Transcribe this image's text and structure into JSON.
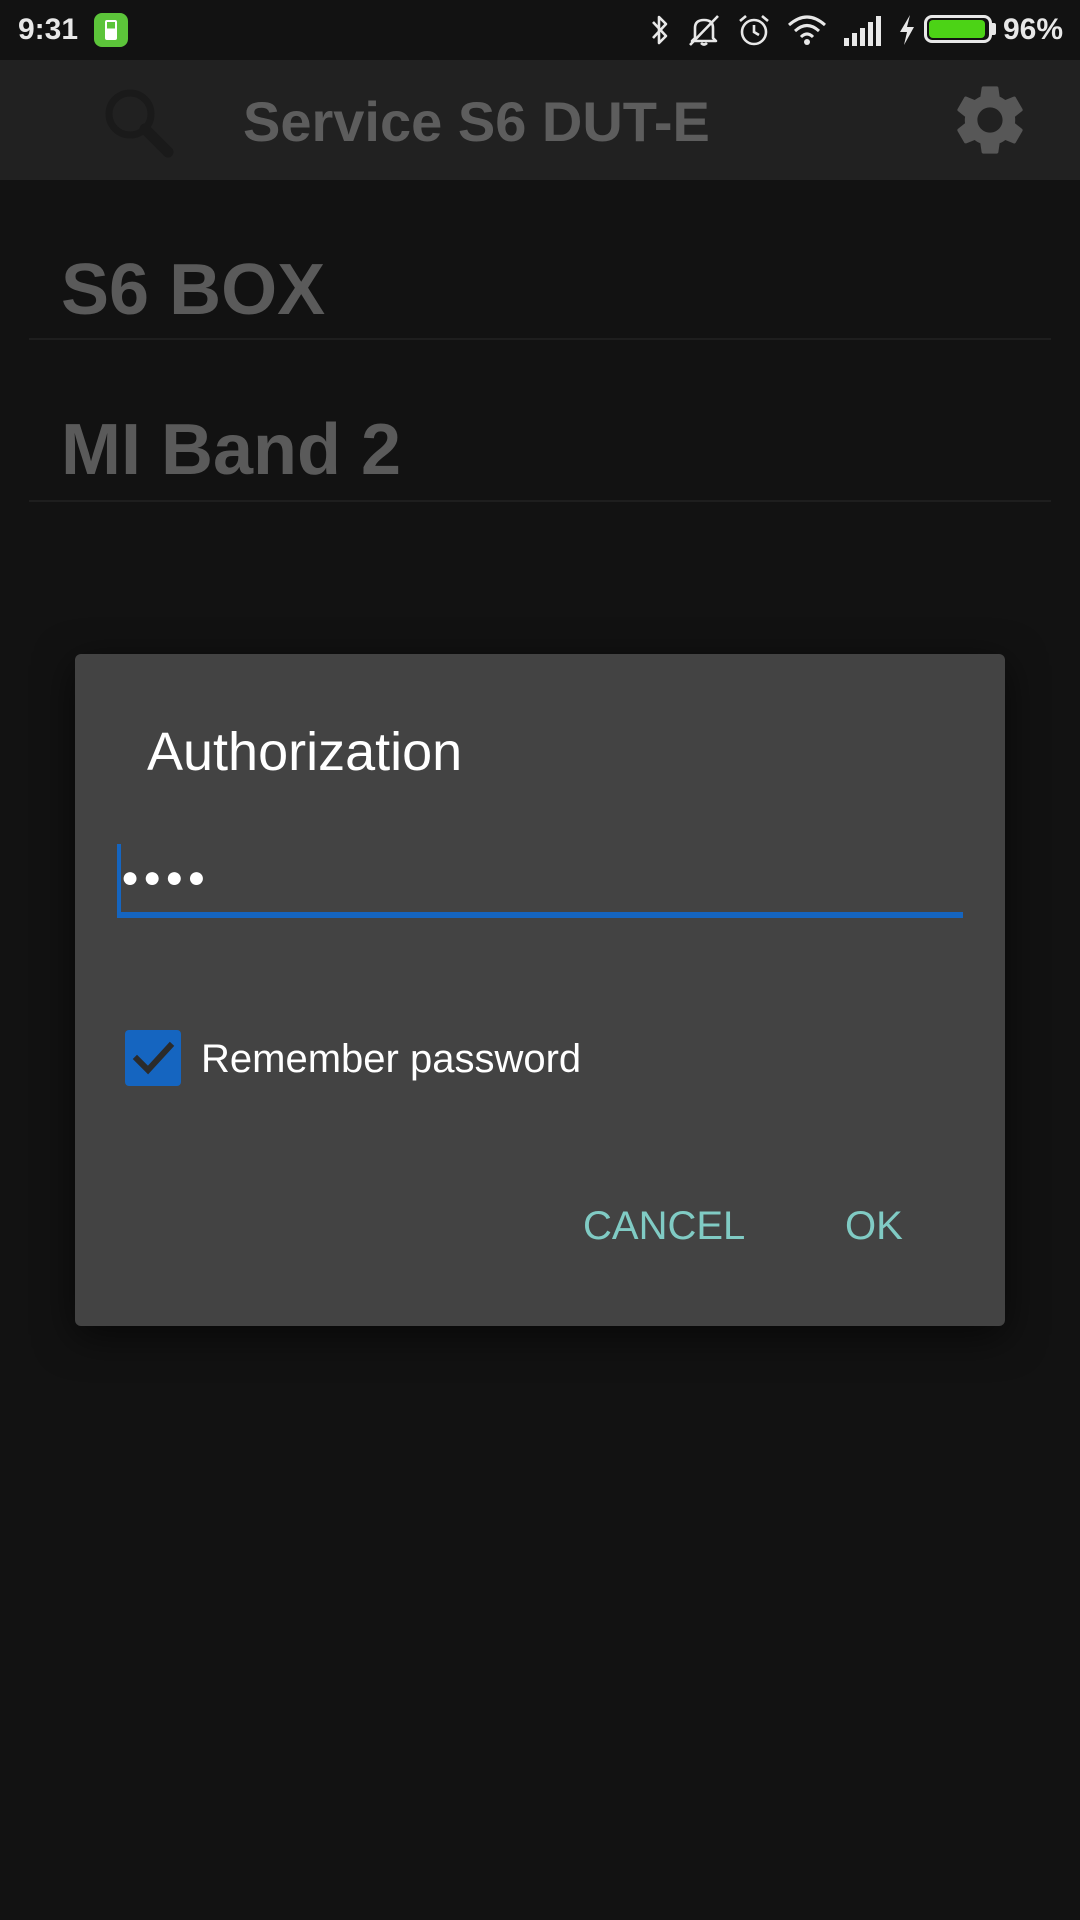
{
  "status_bar": {
    "time": "9:31",
    "battery_percent_label": "96%",
    "battery_level": 0.96,
    "icons": [
      "battery-app-icon",
      "bluetooth-icon",
      "mute-icon",
      "alarm-icon",
      "wifi-icon",
      "signal-icon",
      "charging-icon",
      "battery-icon"
    ]
  },
  "app_bar": {
    "title": "Service S6 DUT-E",
    "left_icon": "search-icon",
    "right_icon": "gear-icon"
  },
  "devices": [
    {
      "name": "S6 BOX"
    },
    {
      "name": "MI Band 2"
    }
  ],
  "dialog": {
    "title": "Authorization",
    "password_masked": "●●●●",
    "remember_label": "Remember password",
    "remember_checked": true,
    "cancel_label": "CANCEL",
    "ok_label": "OK"
  },
  "colors": {
    "background": "#121212",
    "app_bar": "#212121",
    "dialog": "#434343",
    "accent": "#1565c0",
    "button_text": "#80cbc4",
    "battery_fill": "#4cd316"
  }
}
